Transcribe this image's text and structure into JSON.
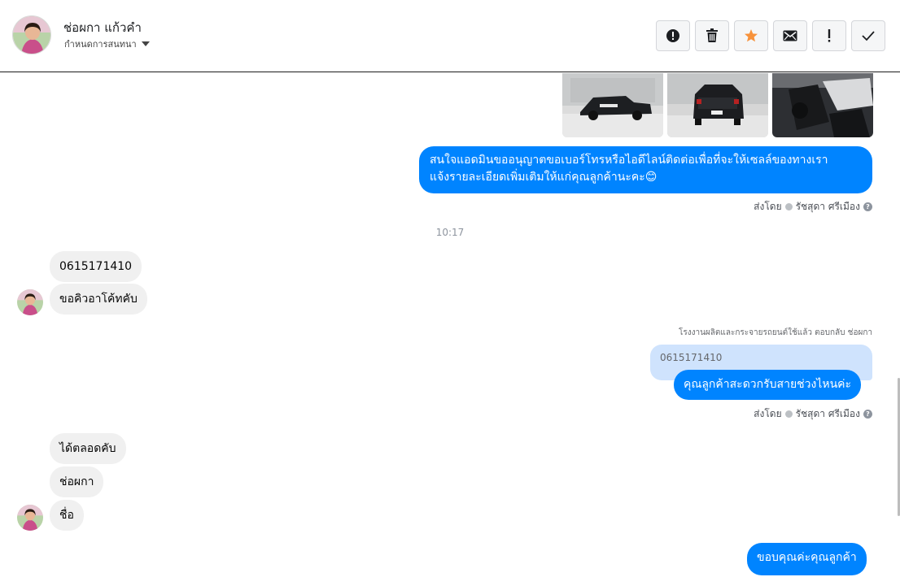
{
  "header": {
    "contact_name": "ช่อผกา แก้วคำ",
    "subtitle": "กำหนดการสนทนา"
  },
  "actions": [
    {
      "icon": "alert-circle-icon",
      "name": "spam-button"
    },
    {
      "icon": "trash-icon",
      "name": "delete-button"
    },
    {
      "icon": "star-icon",
      "name": "star-button",
      "color": "#f7923b"
    },
    {
      "icon": "envelope-icon",
      "name": "mark-unread-button"
    },
    {
      "icon": "exclamation-icon",
      "name": "important-button"
    },
    {
      "icon": "check-icon",
      "name": "done-button"
    }
  ],
  "messages": {
    "outgoing_1": "สนใจแอดมินขออนุญาตขอเบอร์โทรหรือไอดีไลน์ติดต่อเพื่อที่จะให้เซลล์ของทางเรา",
    "outgoing_1_line2": "แจ้งรายละเอียดเพิ่มเติมให้แก่คุณลูกค้านะคะ😊",
    "sent_by_label": "ส่งโดย",
    "sent_by_name": "รัชสุดา ศรีเมือง",
    "timestamp": "10:17",
    "incoming_1": "0615171410",
    "incoming_2": "ขอคิวอาโค้ทคับ",
    "reply_note": "โรงงานผลิตและกระจายรถยนต์ใช้แล้ว ตอบกลับ ช่อผกา",
    "quoted_text": "0615171410",
    "outgoing_2": "คุณลูกค้าสะดวกรับสายช่วงไหนค่ะ",
    "incoming_3": "ได้ตลอดคับ",
    "incoming_4": "ช่อผกา",
    "incoming_5": "ชื่อ",
    "outgoing_3": "ขอบคุณค่ะคุณลูกค้า"
  },
  "colors": {
    "outgoing_bubble": "#0084ff",
    "incoming_bubble": "#f0f0f0",
    "star": "#f7923b"
  }
}
